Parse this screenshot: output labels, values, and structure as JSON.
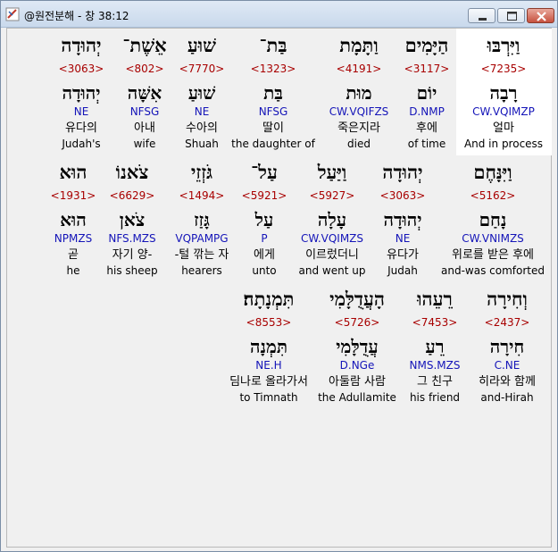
{
  "window": {
    "title": "@원전분해 - 창 38:12"
  },
  "rows": [
    {
      "words": [
        {
          "heb": "וַיִּרְבּוּ",
          "strong": "<7235>",
          "lex": "רָבָה",
          "morph": "CW.VQIMZP",
          "ko": "얼마",
          "en": "And in process",
          "highlighted": true
        },
        {
          "heb": "הַיָּמִים",
          "strong": "<3117>",
          "lex": "יוֹם",
          "morph": "D.NMP",
          "ko": "후에",
          "en": "of time"
        },
        {
          "heb": "וַתָּמָת",
          "strong": "<4191>",
          "lex": "מוּת",
          "morph": "CW.VQIFZS",
          "ko": "죽은지라",
          "en": "died"
        },
        {
          "heb": "בַּת־",
          "strong": "<1323>",
          "lex": "בַּת",
          "morph": "NFSG",
          "ko": "딸이",
          "en": "the daughter of"
        },
        {
          "heb": "שׁוּעַ",
          "strong": "<7770>",
          "lex": "שׁוּעַ",
          "morph": "NE",
          "ko": "수아의",
          "en": "Shuah"
        },
        {
          "heb": "אֵשֶׁת־",
          "strong": "<802>",
          "lex": "אִשָּׁה",
          "morph": "NFSG",
          "ko": "아내",
          "en": "wife"
        },
        {
          "heb": "יְהוּדָה",
          "strong": "<3063>",
          "lex": "יְהוּדָה",
          "morph": "NE",
          "ko": "유다의",
          "en": "Judah's"
        }
      ]
    },
    {
      "words": [
        {
          "heb": "וַיִּנָּחֶם",
          "strong": "<5162>",
          "lex": "נָחַם",
          "morph": "CW.VNIMZS",
          "ko": "위로를 받은 후에",
          "en": "and-was comforted"
        },
        {
          "heb": "יְהוּדָה",
          "strong": "<3063>",
          "lex": "יְהוּדָה",
          "morph": "NE",
          "ko": "유다가",
          "en": "Judah"
        },
        {
          "heb": "וַיַּעַל",
          "strong": "<5927>",
          "lex": "עָלָה",
          "morph": "CW.VQIMZS",
          "ko": "이르렀더니",
          "en": "and went up"
        },
        {
          "heb": "עַל־",
          "strong": "<5921>",
          "lex": "עַל",
          "morph": "P",
          "ko": "에게",
          "en": "unto"
        },
        {
          "heb": "גֹּזְזֵי",
          "strong": "<1494>",
          "lex": "גָּזַז",
          "morph": "VQPAMPG",
          "ko": "-털 깎는 자",
          "en": "hearers"
        },
        {
          "heb": "צֹאנוֹ",
          "strong": "<6629>",
          "lex": "צֹאן",
          "morph": "NFS.MZS",
          "ko": "자기 양-",
          "en": "his sheep"
        },
        {
          "heb": "הוּא",
          "strong": "<1931>",
          "lex": "הוּא",
          "morph": "NPMZS",
          "ko": "곧",
          "en": "he"
        }
      ]
    },
    {
      "words": [
        {
          "heb": "וְחִירָה",
          "strong": "<2437>",
          "lex": "חִירָה",
          "morph": "C.NE",
          "ko": "히라와 함께",
          "en": "and-Hirah"
        },
        {
          "heb": "רֵעֵהוּ",
          "strong": "<7453>",
          "lex": "רֵעַ",
          "morph": "NMS.MZS",
          "ko": "그 친구",
          "en": "his friend"
        },
        {
          "heb": "הָעֲדֻלָּמִי",
          "strong": "<5726>",
          "lex": "עֲדֻלָּמִי",
          "morph": "D.NGe",
          "ko": "아둘람 사람",
          "en": "the Adullamite"
        },
        {
          "heb": "תִּמְנָתָה׃",
          "strong": "<8553>",
          "lex": "תִּמְנָה",
          "morph": "NE.H",
          "ko": "딤나로 올라가서",
          "en": "to Timnath"
        }
      ]
    }
  ]
}
